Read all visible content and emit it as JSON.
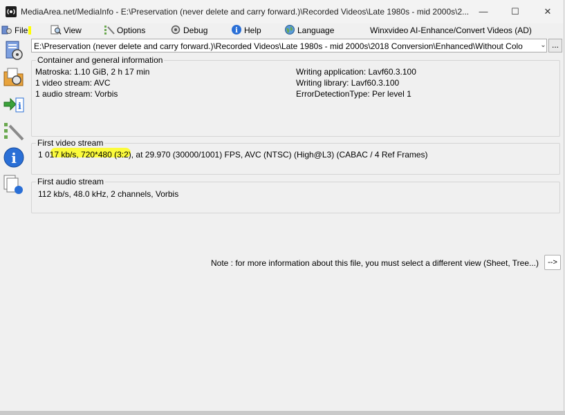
{
  "window": {
    "title": "MediaArea.net/MediaInfo - E:\\Preservation (never delete and carry forward.)\\Recorded Videos\\Late 1980s - mid 2000s\\2...",
    "minimize_icon": "minimize-icon",
    "maximize_icon": "maximize-icon",
    "close_icon": "close-icon"
  },
  "menu": {
    "file": "File",
    "view": "View",
    "options": "Options",
    "debug": "Debug",
    "help": "Help",
    "language": "Language",
    "ad": "Winxvideo AI-Enhance/Convert Videos (AD)"
  },
  "toolbar_icons": [
    "open-file-icon",
    "open-folder-icon",
    "export-icon",
    "preferences-icon",
    "about-icon",
    "view-files-icon"
  ],
  "path": {
    "value": "E:\\Preservation (never delete and carry forward.)\\Recorded Videos\\Late 1980s - mid 2000s\\2018 Conversion\\Enhanced\\Without Colo",
    "browse_label": "..."
  },
  "general": {
    "title": "Container and general information",
    "left": [
      "Matroska: 1.10 GiB, 2 h 17 min",
      "1 video stream: AVC",
      "1 audio stream: Vorbis"
    ],
    "right": [
      "Writing application: Lavf60.3.100",
      "Writing library: Lavf60.3.100",
      "ErrorDetectionType: Per level 1"
    ]
  },
  "video": {
    "title": "First video stream",
    "line": "1 017 kb/s, 720*480 (3:2), at 29.970 (30000/1001) FPS, AVC (NTSC) (High@L3) (CABAC / 4 Ref Frames)"
  },
  "audio": {
    "title": "First audio stream",
    "line": "112 kb/s, 48.0 kHz, 2 channels, Vorbis"
  },
  "note": {
    "text": "Note : for more information about this file, you must select a different view (Sheet, Tree...)",
    "button": "-->"
  },
  "colors": {
    "highlight": "#ffff00",
    "window_bg": "#f0f0f0"
  }
}
